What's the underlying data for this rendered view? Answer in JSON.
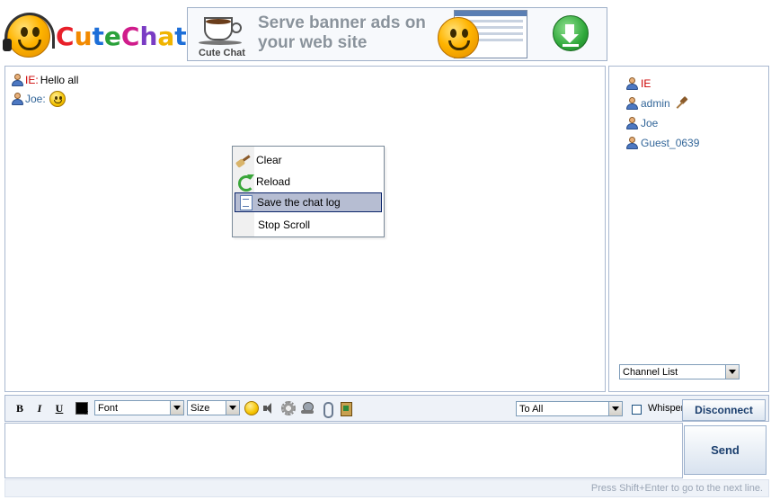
{
  "app": {
    "logo_text": "CuteChat"
  },
  "banner": {
    "title": "Serve banner ads on your web site",
    "caption": "Cute Chat"
  },
  "messages": [
    {
      "user": "IE",
      "sep": ":",
      "text": "Hello all",
      "color": "#cc0000"
    },
    {
      "user": "Joe",
      "sep": ":",
      "text": "",
      "emote": "smile-icon",
      "color": "#336699"
    }
  ],
  "context_menu": {
    "items": [
      {
        "label": "Clear",
        "icon": "broom-icon"
      },
      {
        "label": "Reload",
        "icon": "reload-icon"
      },
      {
        "label": "Save the chat log",
        "icon": "log-icon",
        "active": true
      },
      {
        "label": "Stop Scroll",
        "icon": ""
      }
    ]
  },
  "users": [
    {
      "name": "IE",
      "color": "#cc0000"
    },
    {
      "name": "admin",
      "color": "#336699",
      "badge": "gavel-icon"
    },
    {
      "name": "Joe",
      "color": "#336699"
    },
    {
      "name": "Guest_0639",
      "color": "#336699"
    }
  ],
  "channel_select": {
    "value": "Channel List"
  },
  "toolbar": {
    "bold_label": "B",
    "italic_label": "I",
    "underline_label": "U",
    "font_value": "Font",
    "size_value": "Size",
    "to_value": "To All",
    "whisper_label": "Whisper",
    "disconnect_label": "Disconnect"
  },
  "composer": {
    "send_label": "Send",
    "hint": "Press Shift+Enter to go to the next line."
  }
}
